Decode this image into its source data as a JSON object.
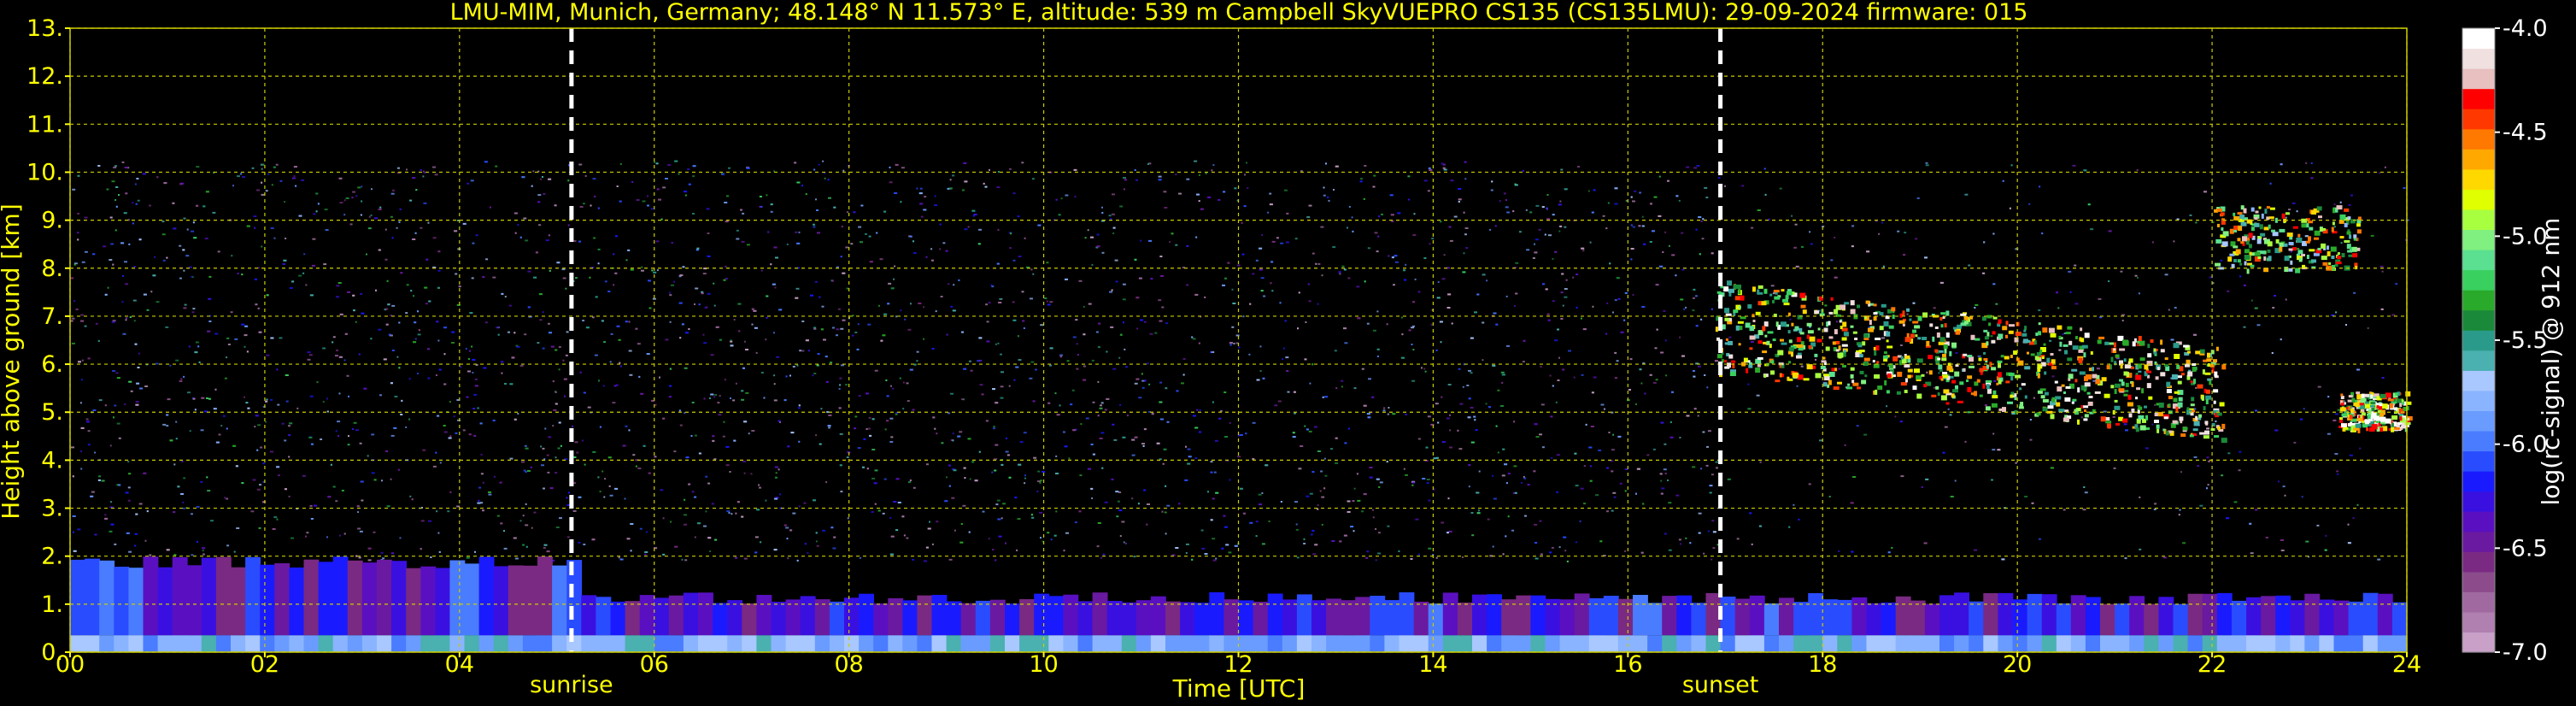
{
  "chart_data": {
    "type": "heatmap",
    "title": "LMU-MIM, Munich, Germany; 48.148° N 11.573° E, altitude: 539 m    Campbell SkyVUEPRO CS135 (CS135LMU): 29-09-2024    firmware: 015",
    "xlabel": "Time [UTC]",
    "ylabel": "Height above ground [km]",
    "xlim": [
      0,
      24
    ],
    "ylim": [
      0,
      13
    ],
    "x_ticks": [
      "00",
      "02",
      "04",
      "06",
      "08",
      "10",
      "12",
      "14",
      "16",
      "18",
      "20",
      "22",
      "24"
    ],
    "y_ticks": [
      "0.",
      "1.",
      "2.",
      "3.",
      "4.",
      "5.",
      "6.",
      "7.",
      "8.",
      "9.",
      "10.",
      "11.",
      "12.",
      "13."
    ],
    "grid": true,
    "markers": [
      {
        "label": "sunrise",
        "time_utc": 5.15
      },
      {
        "label": "sunset",
        "time_utc": 16.95
      }
    ],
    "colorbar": {
      "label": "log(rc-signal) @ 912 nm",
      "ticks": [
        "-4.0",
        "-4.5",
        "-5.0",
        "-5.5",
        "-6.0",
        "-6.5",
        "-7.0"
      ],
      "range": [
        -7.0,
        -4.0
      ],
      "colors": [
        "#c8a0c8",
        "#b080b0",
        "#a06aa0",
        "#8c4c8c",
        "#7a2a82",
        "#6a1aa0",
        "#5a10c0",
        "#3a10e0",
        "#1a1aff",
        "#2a4cff",
        "#4a7cff",
        "#6a9cff",
        "#8ab4ff",
        "#a8c8ff",
        "#4ab0b0",
        "#2a9a8a",
        "#1a8a3a",
        "#2aaa2a",
        "#3ad060",
        "#5ae090",
        "#80f080",
        "#a8ff40",
        "#e0ff00",
        "#ffd800",
        "#ffa800",
        "#ff7800",
        "#ff3800",
        "#ff0000",
        "#e8c0c0",
        "#f0e0e0",
        "#ffffff"
      ]
    },
    "features": [
      {
        "name": "noise",
        "t0": 0,
        "t1": 24,
        "h0": 1.9,
        "h1": 10.25,
        "note": "purple speckle background signal"
      },
      {
        "name": "boundary layer",
        "t0": 0,
        "t1": 24,
        "h0": 0.0,
        "h1": 1.9,
        "value": -6.3
      },
      {
        "name": "cirrus band",
        "t0": 16.9,
        "t1": 22.1,
        "h0": 4.7,
        "h1": 7.5,
        "value": -5.0
      },
      {
        "name": "high cloud streaks",
        "t0": 22.0,
        "t1": 23.5,
        "h0": 7.7,
        "h1": 9.6,
        "value": -5.2
      },
      {
        "name": "mid cloud",
        "t0": 23.3,
        "t1": 24.0,
        "h0": 4.5,
        "h1": 5.6,
        "value": -4.9
      }
    ]
  }
}
